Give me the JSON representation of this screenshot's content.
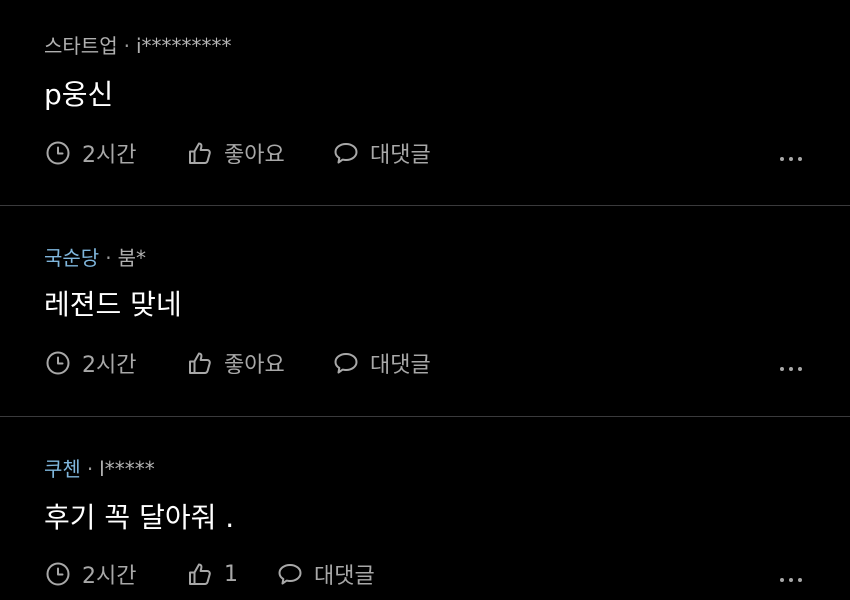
{
  "comments": [
    {
      "company": "스타트업",
      "separator": "·",
      "author": "i*********",
      "text": "p웅신",
      "time": "2시간",
      "like_label": "좋아요",
      "reply_label": "대댓글"
    },
    {
      "company": "국순당",
      "separator": "·",
      "author": "붐*",
      "text": "레젼드 맞네",
      "time": "2시간",
      "like_label": "좋아요",
      "reply_label": "대댓글"
    },
    {
      "company": "쿠첸",
      "separator": "·",
      "author": "l*****",
      "text": "후기 꼭 달아줘 .",
      "time": "2시간",
      "like_label": "1",
      "reply_label": "대댓글"
    }
  ],
  "icons": {
    "time": "clock-icon",
    "like": "thumbs-up-icon",
    "reply": "speech-bubble-icon",
    "more": "more-dots-icon"
  },
  "colors": {
    "background": "#000000",
    "company_accent": "#7fb6dc",
    "muted_text": "#a8a8a8",
    "divider": "#3a3a3c"
  }
}
